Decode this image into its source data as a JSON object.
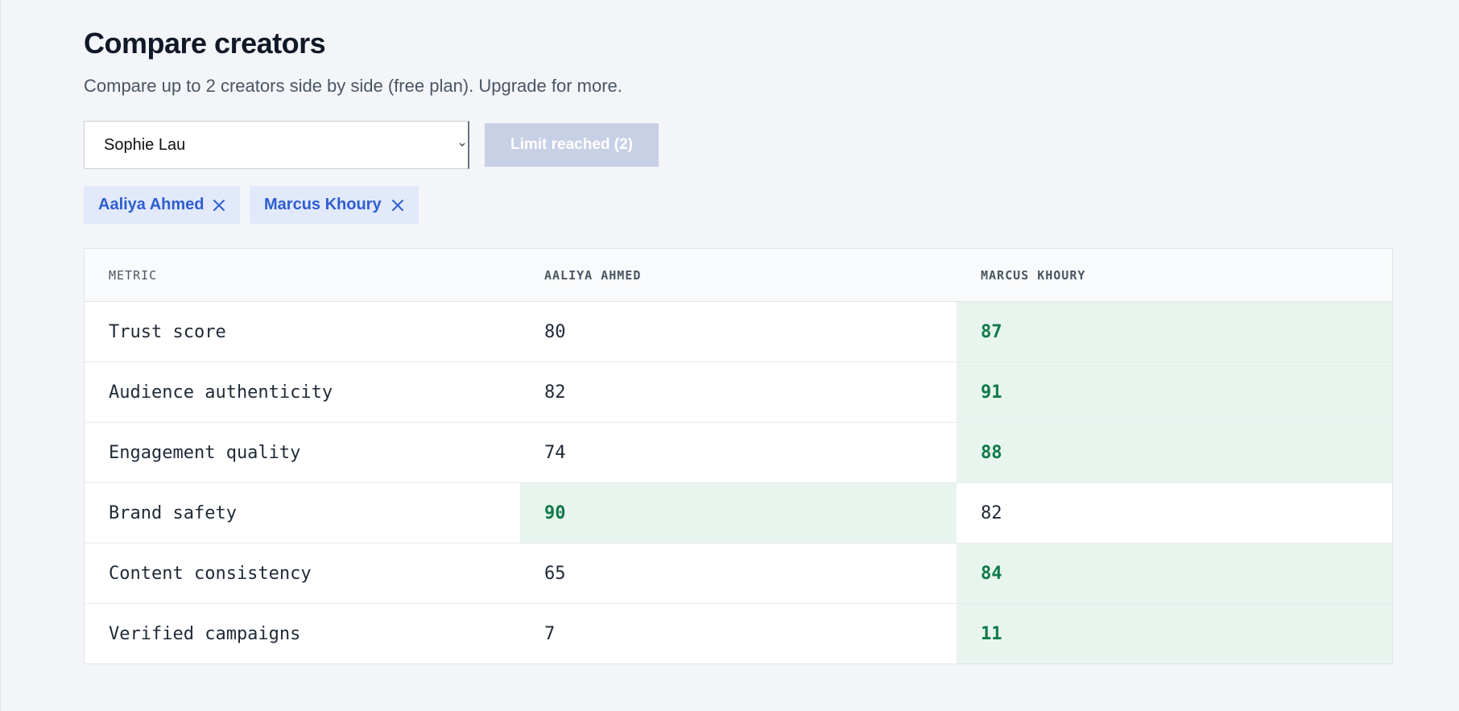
{
  "header": {
    "title": "Compare creators",
    "subtitle": "Compare up to 2 creators side by side (free plan). Upgrade for more."
  },
  "controls": {
    "select_value": "Sophie Lau",
    "limit_button_label": "Limit reached (2)"
  },
  "chips": [
    {
      "label": "Aaliya Ahmed"
    },
    {
      "label": "Marcus Khoury"
    }
  ],
  "table": {
    "headers": [
      "METRIC",
      "AALIYA AHMED",
      "MARCUS KHOURY"
    ],
    "rows": [
      {
        "metric": "Trust score",
        "a": "80",
        "b": "87",
        "best": "b"
      },
      {
        "metric": "Audience authenticity",
        "a": "82",
        "b": "91",
        "best": "b"
      },
      {
        "metric": "Engagement quality",
        "a": "74",
        "b": "88",
        "best": "b"
      },
      {
        "metric": "Brand safety",
        "a": "90",
        "b": "82",
        "best": "a"
      },
      {
        "metric": "Content consistency",
        "a": "65",
        "b": "84",
        "best": "b"
      },
      {
        "metric": "Verified campaigns",
        "a": "7",
        "b": "11",
        "best": "b"
      }
    ]
  },
  "colors": {
    "background": "#f3f5f9",
    "accent": "#2f5ed0",
    "chip_background": "#e1e9fb",
    "best_value": "#0f7a4a",
    "best_background": "#e8f5ee",
    "disabled_button": "#c7d0e5"
  },
  "icons": {
    "select_chevron": "chevron-down-icon",
    "chip_remove": "close-icon"
  }
}
